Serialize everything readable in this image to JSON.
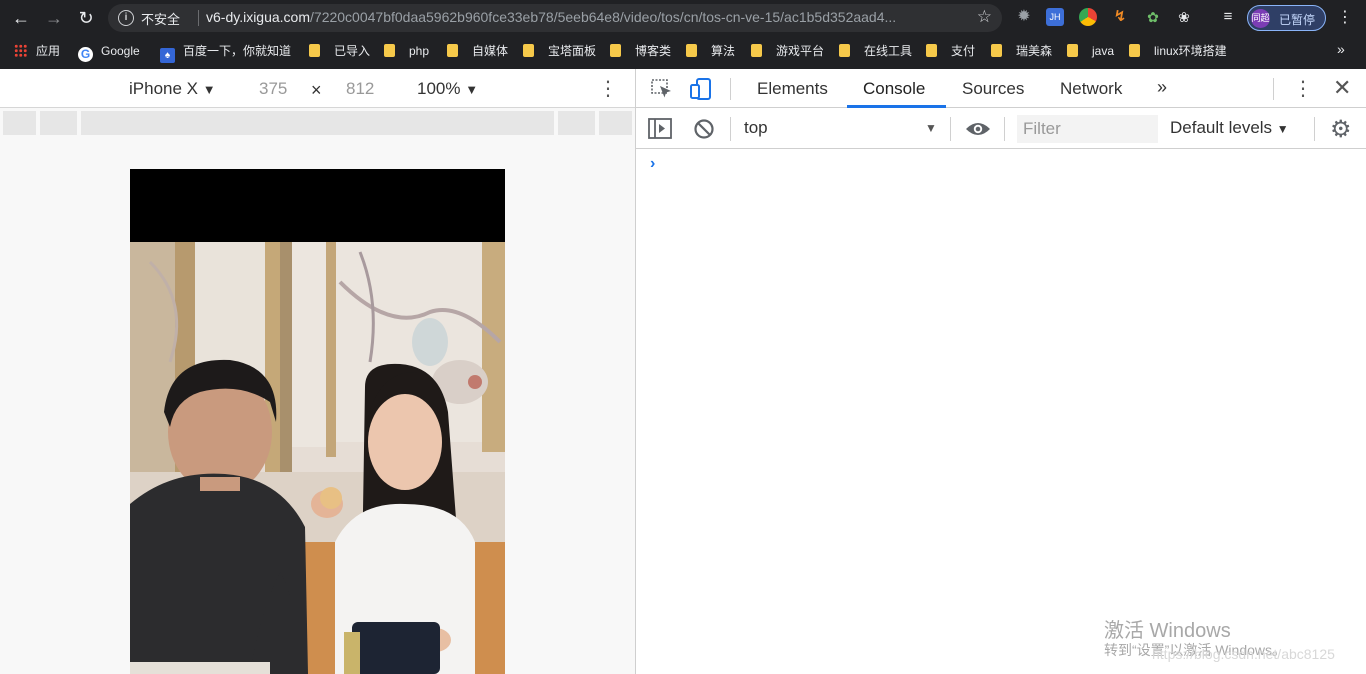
{
  "browser": {
    "back_icon": "arrow-left-icon",
    "forward_icon": "arrow-right-icon",
    "reload_icon": "reload-icon",
    "security_text": "不安全",
    "url_host": "v6-dy.ixigua.com",
    "url_path": "/7220c0047bf0daa5962b960fce33eb78/5eeb64e8/video/tos/cn/tos-cn-ve-15/ac1b5d352aad4...",
    "profile_label": "已暂停",
    "profile_avatar": "同超",
    "ext_jh": "JH"
  },
  "bookmarks": [
    {
      "label": "应用",
      "icon": "apps-grid-icon"
    },
    {
      "label": "Google",
      "icon": "google-icon"
    },
    {
      "label": "百度一下，你就知道",
      "icon": "baidu-icon"
    },
    {
      "label": "已导入",
      "icon": "folder-icon"
    },
    {
      "label": "php",
      "icon": "folder-icon"
    },
    {
      "label": "自媒体",
      "icon": "folder-icon"
    },
    {
      "label": "宝塔面板",
      "icon": "folder-icon"
    },
    {
      "label": "博客类",
      "icon": "folder-icon"
    },
    {
      "label": "算法",
      "icon": "folder-icon"
    },
    {
      "label": "游戏平台",
      "icon": "folder-icon"
    },
    {
      "label": "在线工具",
      "icon": "folder-icon"
    },
    {
      "label": "支付",
      "icon": "folder-icon"
    },
    {
      "label": "瑞美森",
      "icon": "folder-icon"
    },
    {
      "label": "java",
      "icon": "folder-icon"
    },
    {
      "label": "linux环境搭建",
      "icon": "folder-icon"
    }
  ],
  "device_toolbar": {
    "device": "iPhone X",
    "width": "375",
    "times": "×",
    "height": "812",
    "zoom": "100%"
  },
  "devtools": {
    "tabs": [
      "Elements",
      "Console",
      "Sources",
      "Network"
    ],
    "active_tab": "Console",
    "context": "top",
    "filter_placeholder": "Filter",
    "levels": "Default levels",
    "prompt": "›"
  },
  "watermark": {
    "line1": "激活 Windows",
    "line2": "转到“设置”以激活 Windows。",
    "line3": "https://blog.csdn.net/abc8125"
  },
  "colors": {
    "chrome_dark": "#202124",
    "accent_blue": "#1a73e8",
    "folder_yellow": "#f6c94a"
  }
}
